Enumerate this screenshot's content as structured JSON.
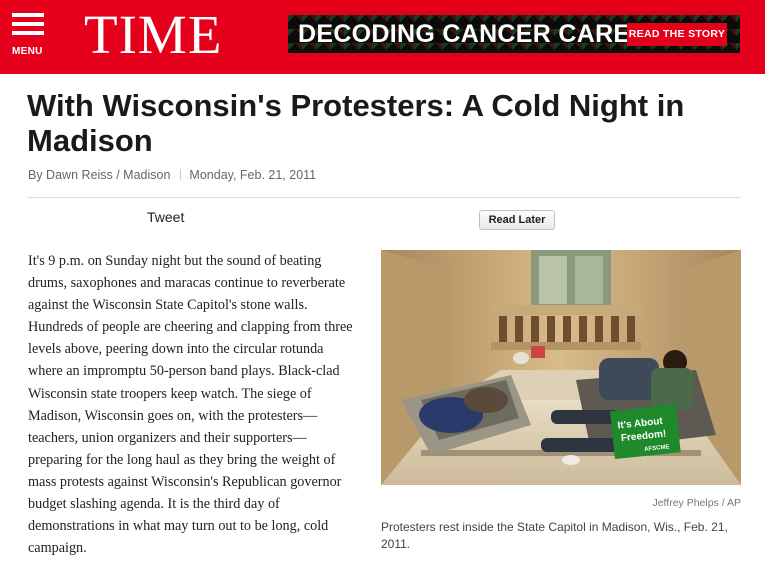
{
  "header": {
    "menu_label": "MENU",
    "logo": "TIME",
    "banner": {
      "text": "DECODING CANCER CARE",
      "button_label": "READ THE STORY"
    }
  },
  "article": {
    "headline": "With Wisconsin's Protesters: A Cold Night in Madison",
    "byline": "By Dawn Reiss / Madison",
    "date": "Monday, Feb. 21, 2011",
    "tweet_label": "Tweet",
    "read_later_label": "Read Later",
    "body": "It's 9 p.m. on Sunday night but the sound of beating drums, saxophones and maracas continue to reverberate against the Wisconsin State Capitol's stone walls. Hundreds of people are cheering and clapping from three levels above, peering down into the circular rotunda where an impromptu 50-person band plays. Black-clad Wisconsin state troopers keep watch. The siege of Madison, Wisconsin goes on, with the protesters—teachers, union organizers and their supporters—preparing for the long haul as they bring the weight of mass protests against Wisconsin's Republican governor budget slashing agenda. It is the third day of demonstrations in what may turn out to be long, cold campaign.",
    "photo": {
      "sign_line1": "It's About",
      "sign_line2": "Freedom!",
      "sign_org": "AFSCME",
      "credit": "Jeffrey Phelps / AP",
      "caption": "Protesters rest inside the State Capitol in Madison, Wis., Feb. 21, 2011."
    }
  },
  "colors": {
    "brand_red": "#e4001b",
    "text_dark": "#1a1a1a",
    "sign_green": "#1f8a2c"
  }
}
